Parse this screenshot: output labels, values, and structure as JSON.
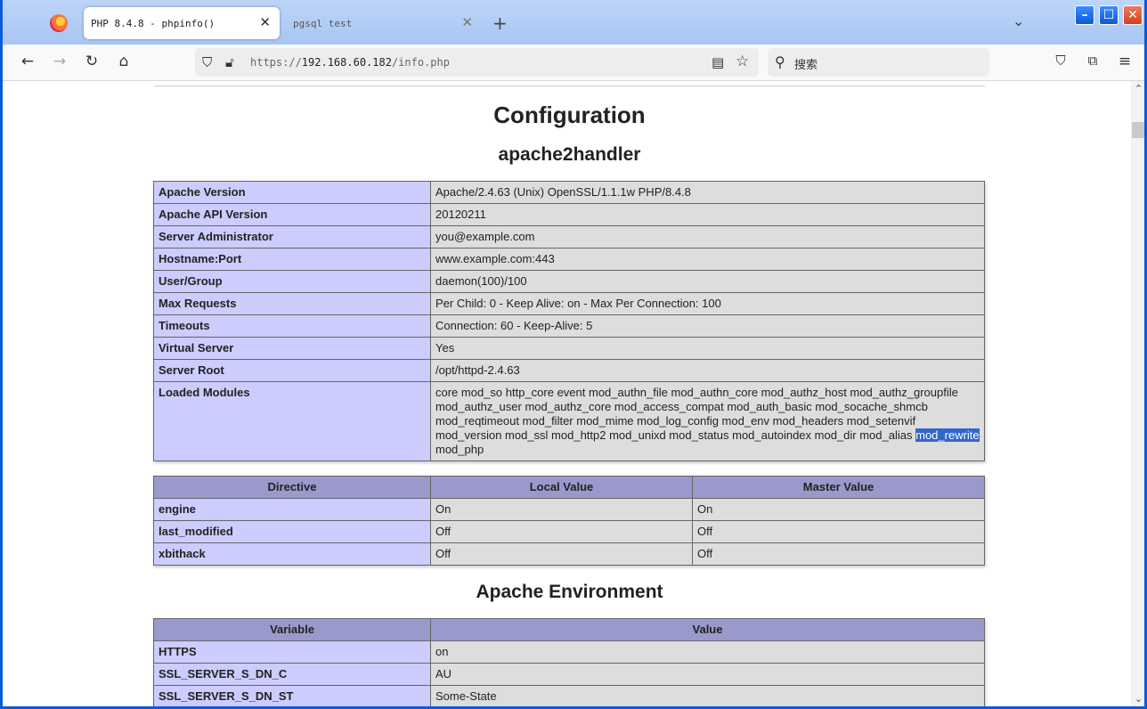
{
  "browser": {
    "tabs": [
      {
        "label": "PHP 8.4.8 - phpinfo()",
        "active": true
      },
      {
        "label": "pgsql test",
        "active": false
      }
    ],
    "new_tab": "+",
    "url_prefix": "https://",
    "url_host": "192.168.60.182",
    "url_path": "/info.php",
    "search_placeholder": "搜索"
  },
  "page": {
    "title": "Configuration",
    "section": "apache2handler",
    "apache_rows": [
      {
        "key": "Apache Version",
        "value": "Apache/2.4.63 (Unix) OpenSSL/1.1.1w PHP/8.4.8"
      },
      {
        "key": "Apache API Version",
        "value": "20120211"
      },
      {
        "key": "Server Administrator",
        "value": "you@example.com"
      },
      {
        "key": "Hostname:Port",
        "value": "www.example.com:443"
      },
      {
        "key": "User/Group",
        "value": "daemon(100)/100"
      },
      {
        "key": "Max Requests",
        "value": "Per Child: 0 - Keep Alive: on - Max Per Connection: 100"
      },
      {
        "key": "Timeouts",
        "value": "Connection: 60 - Keep-Alive: 5"
      },
      {
        "key": "Virtual Server",
        "value": "Yes"
      },
      {
        "key": "Server Root",
        "value": "/opt/httpd-2.4.63"
      }
    ],
    "loaded_modules_label": "Loaded Modules",
    "loaded_modules": {
      "line1": "core mod_so http_core event mod_authn_file mod_authn_core mod_authz_host mod_authz_groupfile",
      "line2": "mod_authz_user mod_authz_core mod_access_compat mod_auth_basic mod_socache_shmcb",
      "line3": "mod_reqtimeout mod_filter mod_mime mod_log_config mod_env mod_headers mod_setenvif",
      "line4_pre": "mod_version mod_ssl mod_http2 mod_unixd mod_status mod_autoindex mod_dir mod_alias",
      "line4_selected": "mod_rewrite",
      "line5": "mod_php"
    },
    "directive_headers": [
      "Directive",
      "Local Value",
      "Master Value"
    ],
    "directives": [
      {
        "name": "engine",
        "local": "On",
        "master": "On"
      },
      {
        "name": "last_modified",
        "local": "Off",
        "master": "Off"
      },
      {
        "name": "xbithack",
        "local": "Off",
        "master": "Off"
      }
    ],
    "env_title": "Apache Environment",
    "env_headers": [
      "Variable",
      "Value"
    ],
    "env_rows": [
      {
        "key": "HTTPS",
        "value": "on"
      },
      {
        "key": "SSL_SERVER_S_DN_C",
        "value": "AU"
      },
      {
        "key": "SSL_SERVER_S_DN_ST",
        "value": "Some-State"
      }
    ]
  }
}
